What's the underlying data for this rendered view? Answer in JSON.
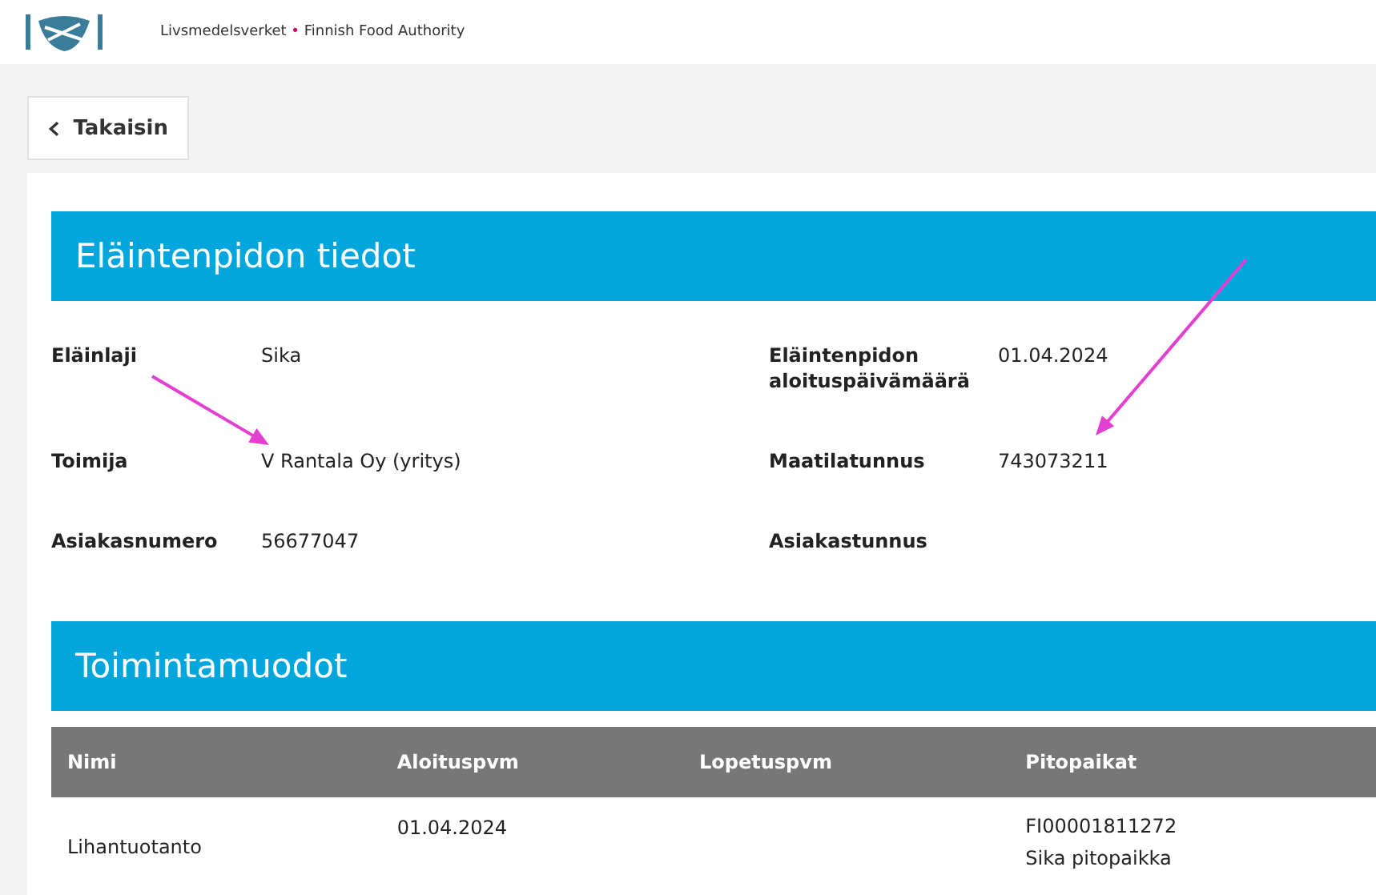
{
  "header": {
    "logo_text": "Livsmedelsverket",
    "logo_subtext": "Finnish Food Authority",
    "separator": "•"
  },
  "back_button": {
    "label": "Takaisin"
  },
  "details": {
    "title": "Eläintenpidon tiedot",
    "fields": [
      {
        "label": "Eläinlaji",
        "value": "Sika"
      },
      {
        "label": "Eläintenpidon aloituspäivämäärä",
        "value": "01.04.2024"
      },
      {
        "label": "Toimija",
        "value": "V Rantala Oy (yritys)"
      },
      {
        "label": "Maatilatunnus",
        "value": "743073211"
      },
      {
        "label": "Asiakasnumero",
        "value": "56677047"
      },
      {
        "label": "Asiakastunnus"
      }
    ]
  },
  "activities": {
    "title": "Toimintamuodot",
    "columns": [
      "Nimi",
      "Aloituspvm",
      "Lopetuspvm",
      "Pitopaikat"
    ],
    "rows": [
      {
        "name": "Lihantuotanto",
        "start": "01.04.2024",
        "places": [
          "FI00001811272",
          "Sika pitopaikka"
        ]
      }
    ]
  },
  "annotations": [
    {
      "kind": "arrow",
      "color": "#e33fd0"
    },
    {
      "kind": "arrow",
      "color": "#e33fd0"
    }
  ]
}
